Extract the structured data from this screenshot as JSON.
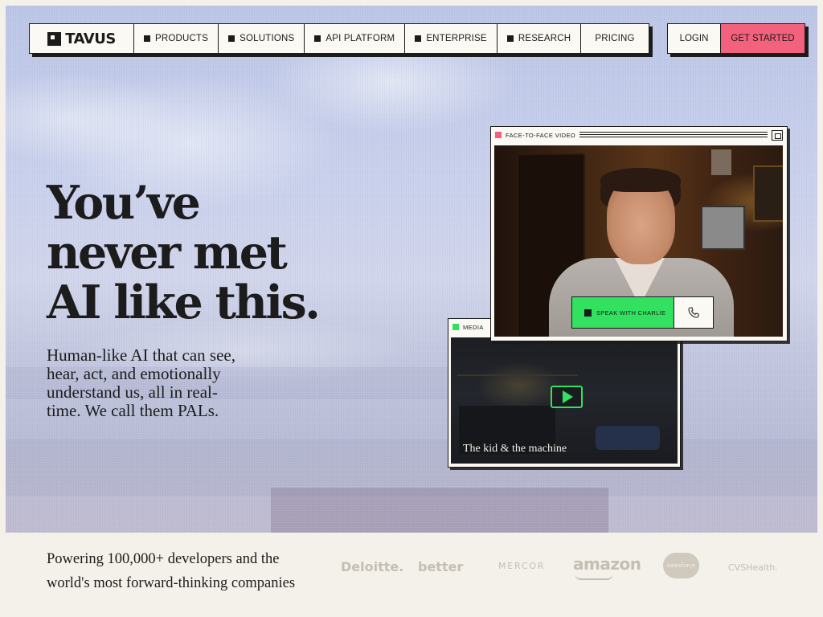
{
  "header": {
    "logo_text": "TAVUS",
    "nav_items": [
      {
        "label": "PRODUCTS"
      },
      {
        "label": "SOLUTIONS"
      },
      {
        "label": "API PLATFORM"
      },
      {
        "label": "ENTERPRISE"
      },
      {
        "label": "RESEARCH"
      },
      {
        "label": "PRICING"
      }
    ],
    "login_label": "LOGIN",
    "cta_label": "GET STARTED"
  },
  "hero": {
    "headline_lines": [
      "You’ve",
      "never met",
      "AI like this."
    ],
    "subhead": "Human-like AI that can see, hear, act, and emotionally understand us, all in real-time. We call them PALs."
  },
  "video_window": {
    "title": "FACE-TO-FACE VIDEO",
    "speak_label": "SPEAK WITH CHARLIE",
    "call_icon": "phone-icon"
  },
  "media_window": {
    "title": "MEDIA",
    "caption": "The kid & the machine",
    "play_icon": "play-icon"
  },
  "footer": {
    "tagline": "Powering 100,000+ developers and the world's most forward-thinking companies",
    "partners": [
      "Deloitte.",
      "better",
      "MERCOR",
      "amazon",
      "salesforce",
      "CVSHealth."
    ]
  },
  "colors": {
    "accent_pink": "#f2627d",
    "accent_green": "#33e160",
    "ink": "#1b1b1b",
    "cream": "#f4f1ea"
  }
}
